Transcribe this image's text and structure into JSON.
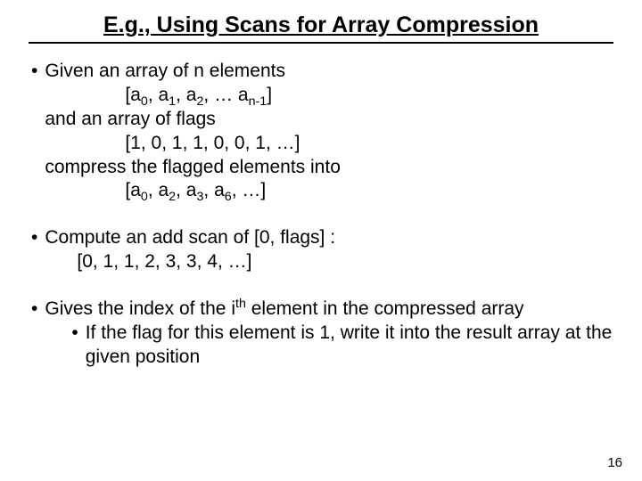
{
  "title": "E.g., Using Scans for Array Compression",
  "b1": {
    "l1": "Given an array of n elements",
    "l2a": "[a",
    "l2b": ", a",
    "l2c": ", a",
    "l2d": ", … a",
    "l2e": "]",
    "s0": "0",
    "s1": "1",
    "s2": "2",
    "sn": "n-1",
    "l3": "and an array of flags",
    "l4": "[1, 0, 1, 1, 0, 0, 1, …]",
    "l5": "compress the flagged elements into",
    "l6a": "[a",
    "l6b": ", a",
    "l6c": ", a",
    "l6d": ", a",
    "l6e": ", …]",
    "r0": "0",
    "r2": "2",
    "r3": "3",
    "r6": "6"
  },
  "b2": {
    "l1": "Compute an add scan of  [0, flags] :",
    "l2": "[0, 1, 1, 2, 3, 3, 4, …]"
  },
  "b3": {
    "l1a": "Gives the index of the i",
    "l1sup": "th",
    "l1b": " element in the compressed array",
    "sub1": "If the flag for this element is 1, write it into the result array at the given position"
  },
  "page": "16"
}
